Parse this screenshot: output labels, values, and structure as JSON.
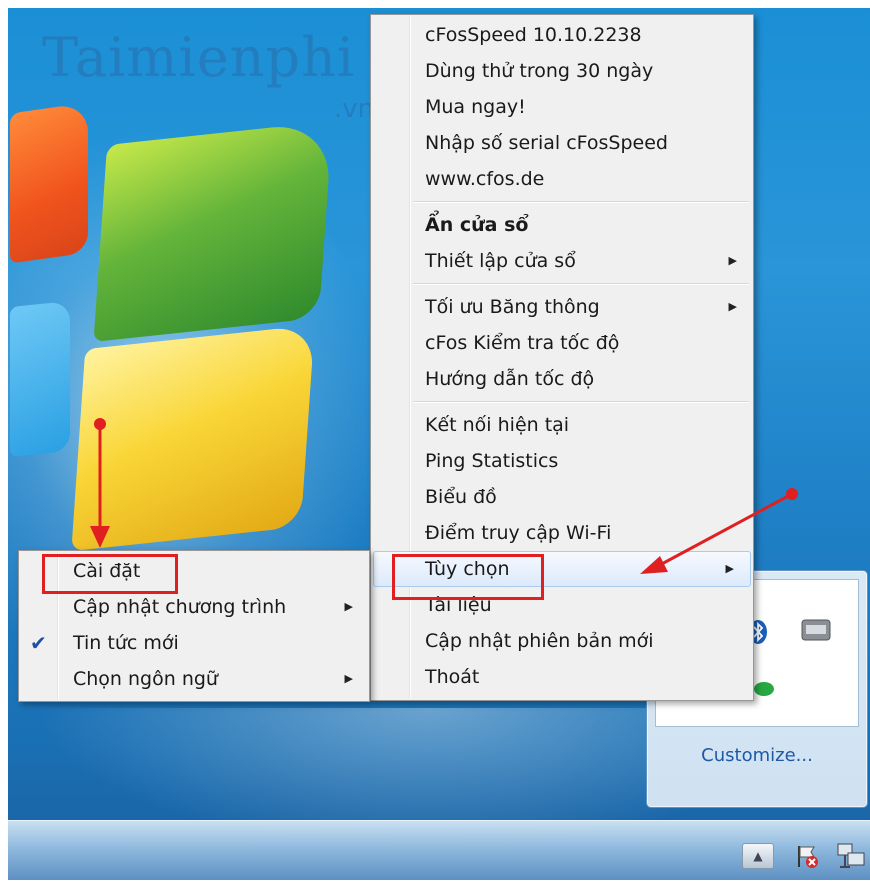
{
  "watermark": {
    "text": "Taimienphi",
    "suffix": ".vn"
  },
  "main_menu": {
    "items": [
      {
        "label": "cFosSpeed 10.10.2238"
      },
      {
        "label": "Dùng thử trong 30 ngày"
      },
      {
        "label": "Mua ngay!"
      },
      {
        "label": "Nhập số serial cFosSpeed"
      },
      {
        "label": "www.cfos.de"
      },
      {
        "label": "Ẩn cửa sổ"
      },
      {
        "label": "Thiết lập cửa sổ"
      },
      {
        "label": "Tối ưu Băng thông"
      },
      {
        "label": "cFos Kiểm tra tốc độ"
      },
      {
        "label": "Hướng dẫn tốc độ"
      },
      {
        "label": "Kết nối hiện tại"
      },
      {
        "label": "Ping Statistics"
      },
      {
        "label": "Biểu đồ"
      },
      {
        "label": "Điểm truy cập Wi-Fi"
      },
      {
        "label": "Tùy chọn"
      },
      {
        "label": "Tài liệu"
      },
      {
        "label": "Cập nhật phiên bản mới"
      },
      {
        "label": "Thoát"
      }
    ]
  },
  "sub_menu": {
    "items": [
      {
        "label": "Cài đặt"
      },
      {
        "label": "Cập nhật chương trình"
      },
      {
        "label": "Tin tức mới",
        "checked": true
      },
      {
        "label": "Chọn ngôn ngữ"
      }
    ]
  },
  "tray_panel": {
    "customize_label": "Customize..."
  },
  "icons": {
    "arrow": "submenu-arrow-icon",
    "check": "checkmark-icon",
    "tray": [
      "bluetooth-icon",
      "vmware-icon",
      "green-status-icon"
    ],
    "taskbar": [
      "show-hidden-icons-icon",
      "action-center-flag-icon",
      "network-icon"
    ]
  },
  "colors": {
    "annotation_red": "#e02020",
    "menu_bg": "#f0f0f0",
    "highlight": "#dceafb",
    "link_blue": "#1c5aa5",
    "check_blue": "#1f4ea8"
  }
}
